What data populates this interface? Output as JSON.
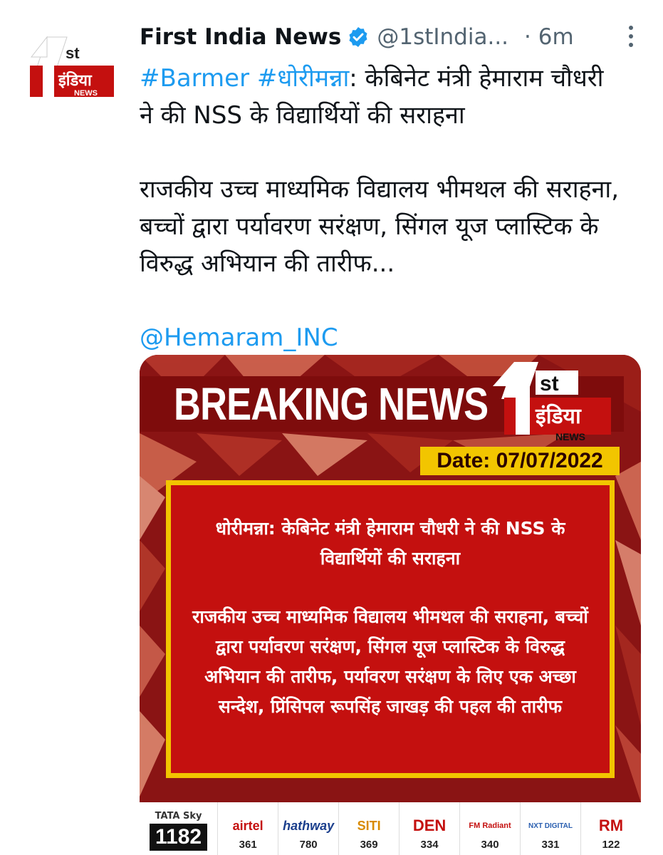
{
  "author": {
    "name": "First India News",
    "handle": "@1stIndia...",
    "time_separator": "·",
    "time": "6m",
    "avatar_line1": "st",
    "avatar_line2": "इंडिया",
    "avatar_line3": "NEWS"
  },
  "tweet": {
    "hashtag1": "#Barmer",
    "hashtag2": "#धोरीमन्ना",
    "line1_rest": ": केबिनेट मंत्री हेमाराम चौधरी",
    "line2": "ने की NSS के विद्यार्थियों की सराहना",
    "para2": "राजकीय उच्च माध्यमिक विद्यालय भीमथल की सराहना, बच्चों द्वारा पर्यावरण सरंक्षण, सिंगल यूज प्लास्टिक के विरुद्ध अभियान की तारीफ...",
    "mention": "@Hemaram_INC"
  },
  "media": {
    "banner": "BREAKING NEWS",
    "brand_st": "st",
    "brand_name": "इंडिया",
    "brand_news": "NEWS",
    "date": "Date: 07/07/2022",
    "headline": "धोरीमन्ना: केबिनेट मंत्री हेमाराम चौधरी ने की NSS के विद्यार्थियों की सराहना",
    "body": "राजकीय उच्च माध्यमिक विद्यालय भीमथल की सराहना, बच्चों द्वारा पर्यावरण सरंक्षण, सिंगल यूज प्लास्टिक के विरुद्ध अभियान की तारीफ, पर्यावरण सरंक्षण के लिए एक अच्छा सन्देश, प्रिंसिपल रूपसिंह जाखड़ की पहल की तारीफ",
    "channels": [
      {
        "name": "TATA Sky",
        "number": "1182"
      },
      {
        "name": "airtel",
        "number": "361"
      },
      {
        "name": "hathway",
        "number": "780"
      },
      {
        "name": "SITI",
        "number": "369"
      },
      {
        "name": "DEN",
        "number": "334"
      },
      {
        "name": "FM Radiant",
        "number": "340"
      },
      {
        "name": "NXT DIGITAL",
        "number": "331"
      },
      {
        "name": "RM",
        "number": "122"
      }
    ]
  },
  "colors": {
    "link": "#1d9bf0",
    "brand_red": "#c4100f",
    "date_yellow": "#f2c500",
    "verified": "#1d9bf0"
  }
}
